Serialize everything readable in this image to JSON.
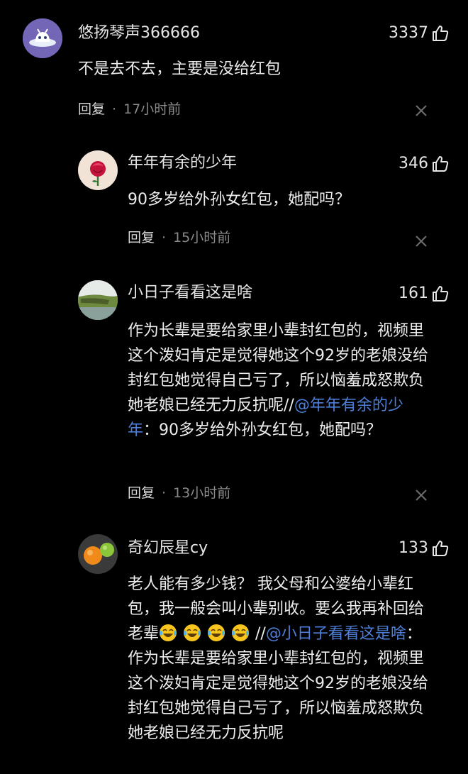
{
  "comments": [
    {
      "username": "悠扬琴声366666",
      "likes": "3337",
      "text": "不是去不去，主要是没给红包",
      "reply_label": "回复",
      "time": "17小时前",
      "avatar_icon": "ufo-avatar"
    },
    {
      "username": "年年有余的少年",
      "likes": "346",
      "text": "90多岁给外孙女红包，她配吗？",
      "reply_label": "回复",
      "time": "15小时前",
      "avatar_icon": "rose-avatar"
    },
    {
      "username": "小日子看看这是啥",
      "likes": "161",
      "text_main": "作为长辈是要给家里小辈封红包的，视频里这个泼妇肯定是觉得她这个92岁的老娘没给封红包她觉得自己亏了，所以恼羞成怒欺负她老娘已经无力反抗呢//",
      "mention": "@年年有余的少年",
      "text_quote": "：90多岁给外孙女红包，她配吗？",
      "reply_label": "回复",
      "time": "13小时前",
      "avatar_icon": "landscape-avatar"
    },
    {
      "username": "奇幻辰星cy",
      "likes": "133",
      "text_main": "老人能有多少钱？ 我父母和公婆给小辈红包，我一般会叫小辈别收。要么我再补回给老辈",
      "emoji_icon": "laughing-crying-emoji",
      "separator": "//",
      "mention": "@小日子看看这是啥",
      "text_quote": "：作为长辈是要给家里小辈封红包的，视频里这个泼妇肯定是觉得她这个92岁的老娘没给封红包她觉得自己亏了，所以恼羞成怒欺负她老娘已经无力反抗呢",
      "avatar_icon": "fruit-avatar"
    }
  ],
  "colors": {
    "background": "#000000",
    "text": "#ededed",
    "muted": "#8a8a8a",
    "mention": "#4e7fd8"
  }
}
